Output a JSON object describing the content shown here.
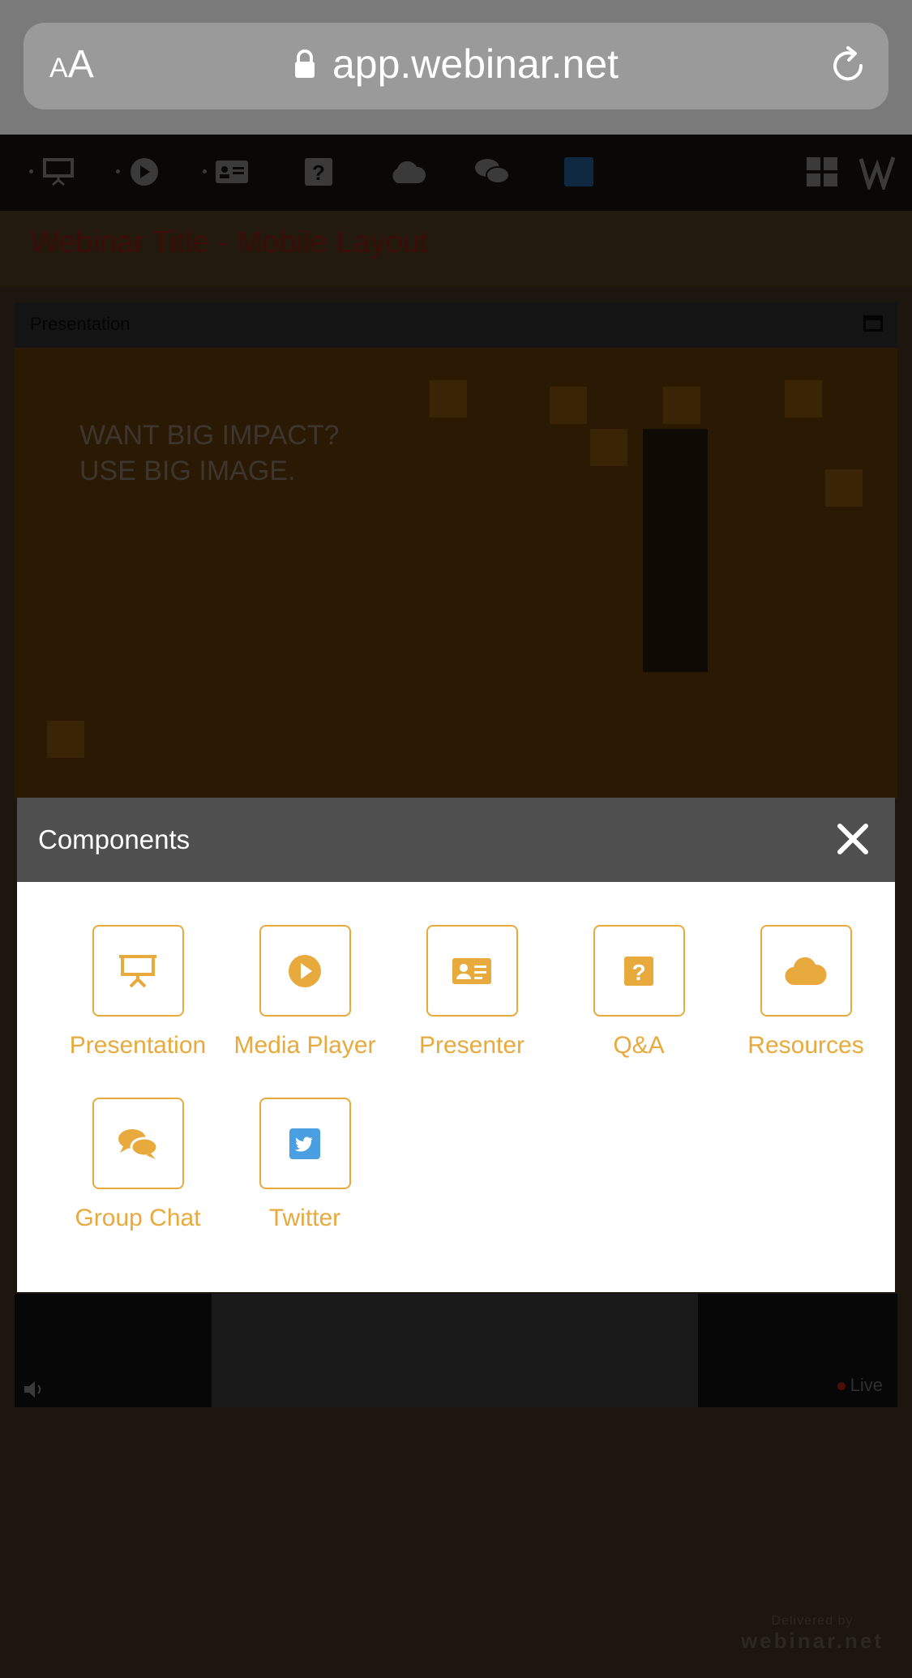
{
  "browser": {
    "text_size_small": "A",
    "text_size_large": "A",
    "url": "app.webinar.net"
  },
  "webinar": {
    "title": "Webinar Title - Mobile Layout",
    "presentation_label": "Presentation",
    "slide_text_line1": "WANT BIG IMPACT?",
    "slide_text_line2": "USE BIG IMAGE.",
    "live_label": "Live",
    "delivered_by": "Delivered by",
    "brand": "webinar.net"
  },
  "modal": {
    "title": "Components",
    "components": [
      {
        "label": "Presentation",
        "icon": "presentation-icon"
      },
      {
        "label": "Media Player",
        "icon": "play-icon"
      },
      {
        "label": "Presenter",
        "icon": "id-card-icon"
      },
      {
        "label": "Q&A",
        "icon": "question-icon"
      },
      {
        "label": "Resources",
        "icon": "cloud-icon"
      },
      {
        "label": "Group Chat",
        "icon": "chat-icon"
      },
      {
        "label": "Twitter",
        "icon": "twitter-icon"
      }
    ]
  },
  "colors": {
    "accent": "#e8a93d",
    "twitter": "#4a9fe3",
    "modal_header": "#4f4f4f"
  }
}
